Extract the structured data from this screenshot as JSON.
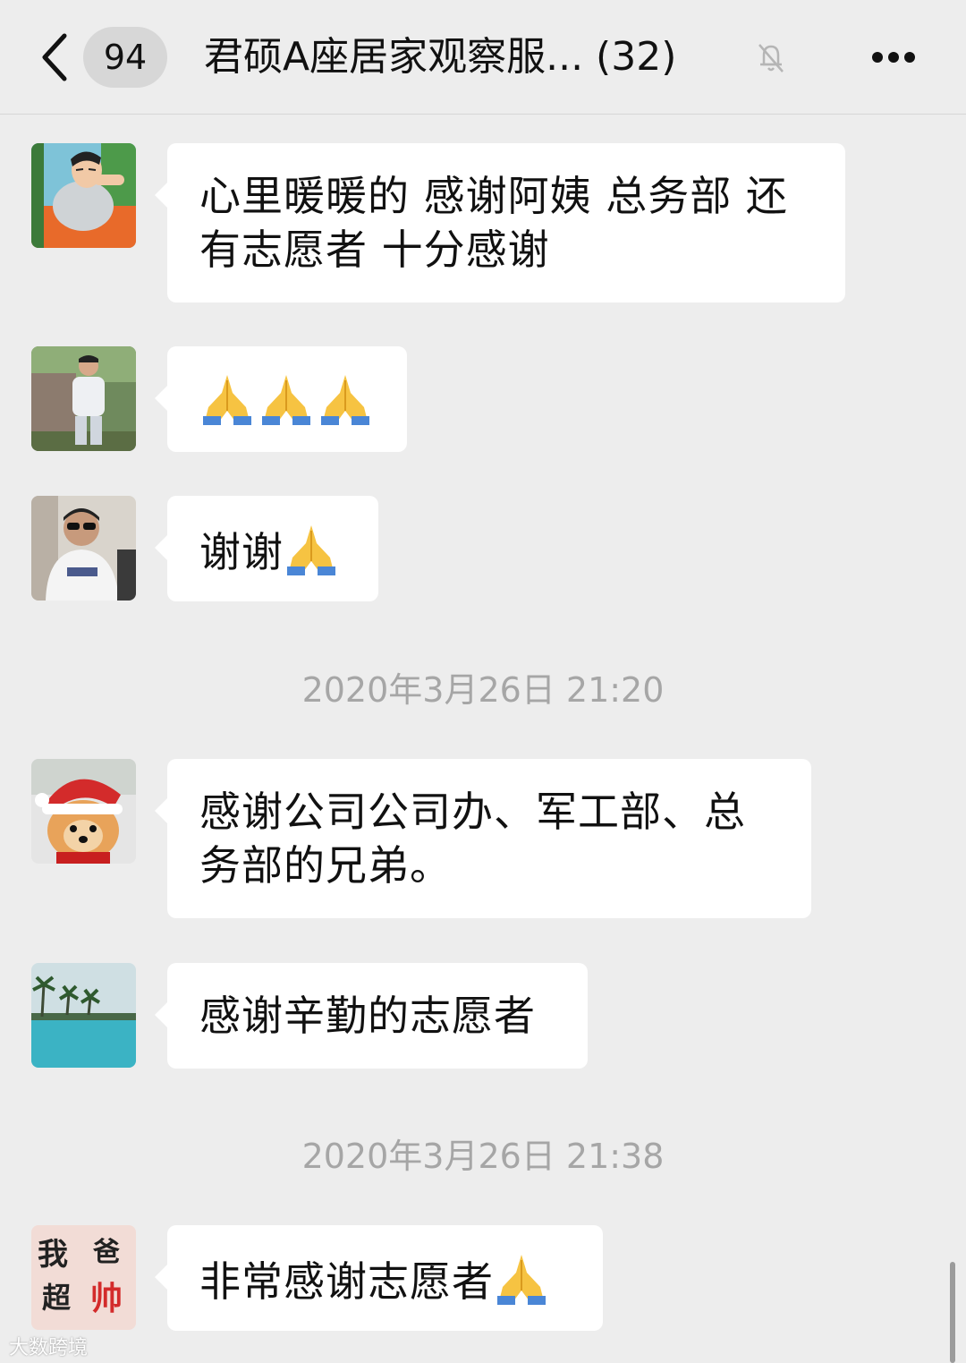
{
  "header": {
    "unread_count": "94",
    "title": "君硕A座居家观察服... (32)",
    "mute_icon": "muted-bell-icon",
    "more_icon": "ellipsis-icon"
  },
  "messages": [
    {
      "avatar": "avatar-cartoon-man",
      "text": "心里暖暖的 感谢阿姨 总务部 还\n有志愿者 十分感谢"
    },
    {
      "avatar": "avatar-man-outdoor",
      "text": ""
    },
    {
      "avatar": "avatar-man-sunglasses",
      "text": "谢谢"
    },
    {
      "avatar": "avatar-dog-santa-hat",
      "text": "感谢公司公司办、军工部、总\n务部的兄弟。"
    },
    {
      "avatar": "avatar-pool-palms",
      "text": "感谢辛勤的志愿者"
    },
    {
      "avatar": "avatar-calligraphy",
      "text": "非常感谢志愿者"
    }
  ],
  "emoji": "folded-hands-icon",
  "timestamps": [
    "2020年3月26日 21:20",
    "2020年3月26日 21:38"
  ],
  "avatar_calligraphy_text": [
    "我",
    "爸",
    "超",
    "帅"
  ],
  "watermark": "大数跨境",
  "colors": {
    "background": "#ededed",
    "bubble": "#ffffff",
    "timestamp": "#a6a6a6"
  }
}
